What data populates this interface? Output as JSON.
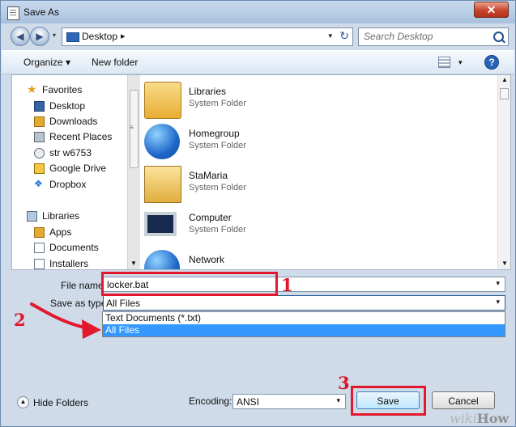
{
  "window": {
    "title": "Save As",
    "close_label": "✕",
    "icons": {
      "document": "document-icon",
      "close": "close-icon"
    }
  },
  "nav": {
    "back_label": "◀",
    "forward_label": "▶",
    "history_caret": "▾",
    "address_location": "Desktop",
    "address_chevron": "▸",
    "address_caret": "▾",
    "refresh_label": "↻",
    "search_placeholder": "Search Desktop",
    "icons": {
      "desktop": "desktop-icon",
      "search": "search-icon",
      "refresh": "refresh-icon"
    }
  },
  "toolbar": {
    "organize_label": "Organize ▾",
    "new_folder_label": "New folder",
    "view_caret": "▾",
    "help_label": "?",
    "icons": {
      "view": "view-options-icon",
      "help": "help-icon"
    }
  },
  "sidebar": {
    "favorites_header": "Favorites",
    "favorites": [
      {
        "label": "Desktop"
      },
      {
        "label": "Downloads"
      },
      {
        "label": "Recent Places"
      },
      {
        "label": "str w6753"
      },
      {
        "label": "Google Drive"
      },
      {
        "label": "Dropbox"
      }
    ],
    "libraries_header": "Libraries",
    "libraries": [
      {
        "label": "Apps"
      },
      {
        "label": "Documents"
      },
      {
        "label": "Installers"
      }
    ],
    "splitter_grip": "≡",
    "scroll_down": "▼"
  },
  "files": [
    {
      "name": "Libraries",
      "type": "System Folder"
    },
    {
      "name": "Homegroup",
      "type": "System Folder"
    },
    {
      "name": "StaMaria",
      "type": "System Folder"
    },
    {
      "name": "Computer",
      "type": "System Folder"
    },
    {
      "name": "Network",
      "type": ""
    }
  ],
  "filescroll": {
    "up": "▲",
    "down": "▼"
  },
  "form": {
    "file_name_label": "File name:",
    "file_name_value": "locker.bat",
    "file_name_caret": "▾",
    "save_as_type_label": "Save as type:",
    "save_as_type_value": "All Files",
    "type_caret": "▾",
    "type_options": [
      {
        "label": "Text Documents (*.txt)"
      },
      {
        "label": "All Files"
      }
    ]
  },
  "footer": {
    "hide_folders_label": "Hide Folders",
    "hide_icon": "▲",
    "encoding_label": "Encoding:",
    "encoding_value": "ANSI",
    "encoding_caret": "▾",
    "save_label": "Save",
    "cancel_label": "Cancel"
  },
  "annotations": {
    "step1": "1",
    "step2": "2",
    "step3": "3",
    "watermark_prefix": "wiki",
    "watermark_suffix": "How",
    "color": "#e3182d"
  }
}
